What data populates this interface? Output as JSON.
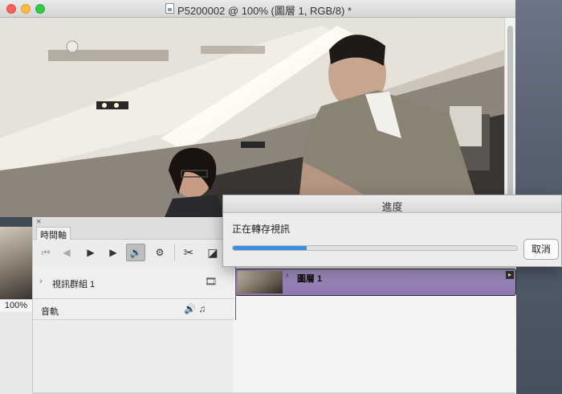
{
  "window": {
    "title": "P5200002 @ 100% (圖層 1, RGB/8) *"
  },
  "navigator": {
    "zoom": "100%"
  },
  "timeline": {
    "close_glyph": "×",
    "tab_label": "時間軸",
    "transport": {
      "first_frame_icon": "⏮",
      "prev_frame_icon": "◀",
      "play_icon": "▶",
      "next_frame_icon": "▶",
      "audio_icon": "🔊",
      "settings_icon": "⚙",
      "split_icon": "✂",
      "transition_icon": "◪"
    },
    "tracks": [
      {
        "label": "視訊群組 1",
        "icon": "🎞"
      },
      {
        "label": "音軌",
        "icon": "🔊 ♫"
      }
    ],
    "clip": {
      "name": "圖層 1"
    }
  },
  "progress_dialog": {
    "title": "進度",
    "message": "正在轉存視訊",
    "progress_fraction": 0.26,
    "cancel_label": "取消"
  },
  "colors": {
    "progress_fill": "#3f8fe0",
    "clip_fill": "#8d76ae",
    "playhead": "#c0392b"
  }
}
